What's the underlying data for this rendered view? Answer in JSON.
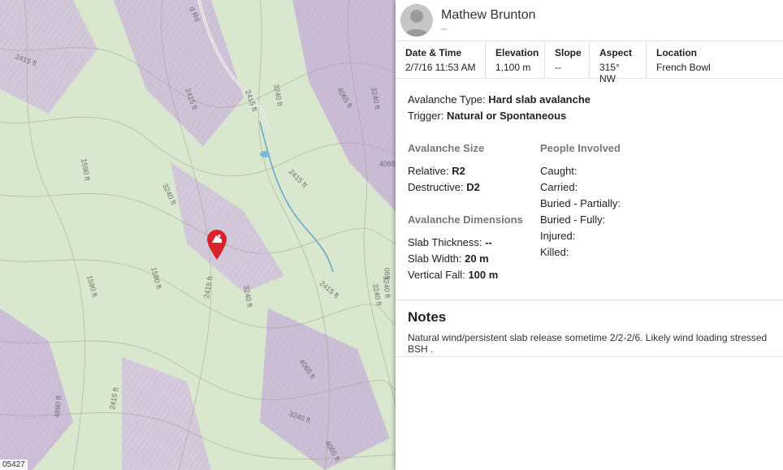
{
  "map": {
    "scale_text": "05427",
    "road_label": "d Rd",
    "contour_labels": [
      "2415 ft",
      "2415 ft",
      "2415 ft",
      "3240 ft",
      "4065 ft",
      "3240 ft",
      "1590 ft",
      "3240 ft",
      "2415 ft",
      "4065",
      "1590 ft",
      "1590 ft",
      "2415 ft",
      "3240 ft",
      "2415 ft",
      "3240 ft",
      "4065 ft",
      "2415 ft",
      "3240 ft",
      "4890 ft",
      "3240 ft",
      "069",
      "4065 ft"
    ],
    "marker_icon": "avalanche-marker-icon"
  },
  "header": {
    "user_name": "Mathew Brunton",
    "user_sub": "--",
    "avatar_icon": "user-avatar-icon"
  },
  "stats": [
    {
      "label": "Date & Time",
      "value": "2/7/16 11:53 AM"
    },
    {
      "label": "Elevation",
      "value": "1,100 m"
    },
    {
      "label": "Slope",
      "value": "--"
    },
    {
      "label": "Aspect",
      "value": "315° NW"
    },
    {
      "label": "Location",
      "value": "French Bowl"
    }
  ],
  "details": {
    "type_label": "Avalanche Type:",
    "type_value": "Hard slab avalanche",
    "trigger_label": "Trigger:",
    "trigger_value": "Natural or Spontaneous"
  },
  "size": {
    "title": "Avalanche Size",
    "relative_label": "Relative:",
    "relative_value": "R2",
    "destructive_label": "Destructive:",
    "destructive_value": "D2"
  },
  "dimensions": {
    "title": "Avalanche Dimensions",
    "thickness_label": "Slab Thickness:",
    "thickness_value": "--",
    "width_label": "Slab Width:",
    "width_value": "20 m",
    "fall_label": "Vertical Fall:",
    "fall_value": "100 m"
  },
  "people": {
    "title": "People Involved",
    "caught": "Caught:",
    "carried": "Carried:",
    "buried_partially": "Buried - Partially:",
    "buried_fully": "Buried - Fully:",
    "injured": "Injured:",
    "killed": "Killed:"
  },
  "notes": {
    "title": "Notes",
    "text": "Natural wind/persistent slab release sometime 2/2-2/6. Likely wind loading stressed BSH ."
  },
  "colors": {
    "map_valley": "#d9e7cf",
    "map_ridge": "#c9b8d6",
    "marker": "#d8232a",
    "stream": "#5a9fc9"
  }
}
